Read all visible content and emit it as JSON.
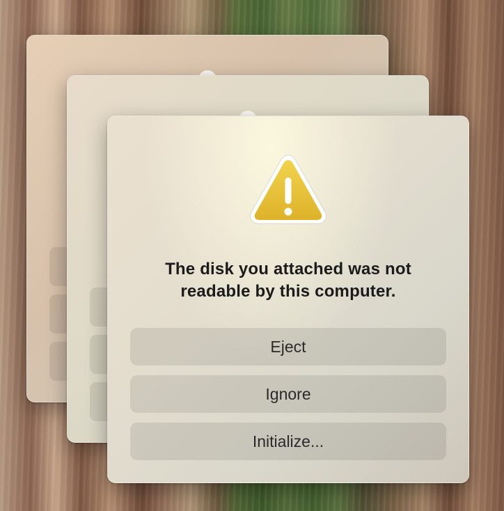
{
  "alert": {
    "message_line1": "The disk you attached was not",
    "message_line2": "readable by this computer.",
    "icon": "warning-icon",
    "buttons": {
      "eject": "Eject",
      "ignore": "Ignore",
      "initialize": "Initialize..."
    }
  },
  "colors": {
    "warning_fill": "#E9C233",
    "warning_border": "#FFFFFF",
    "text": "#1B1B1B"
  }
}
